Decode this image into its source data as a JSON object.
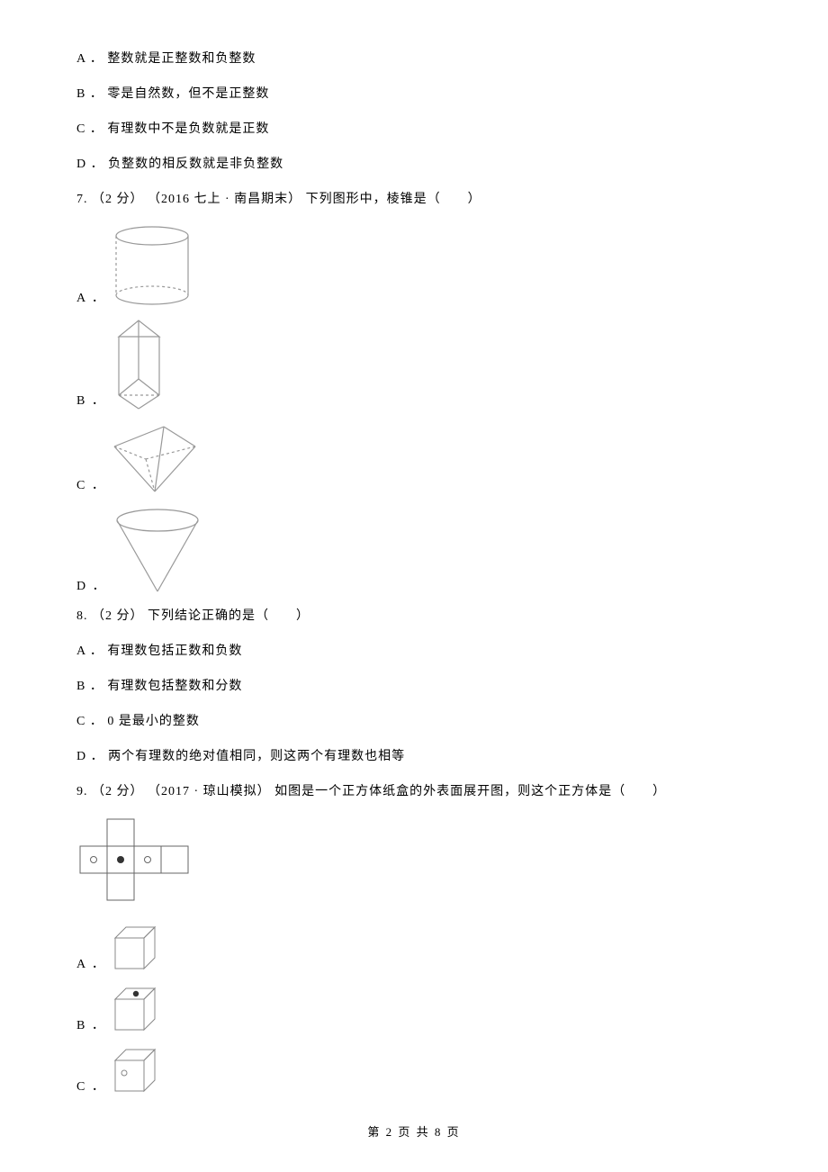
{
  "q6": {
    "a": "A ． 整数就是正整数和负整数",
    "b": "B ． 零是自然数，但不是正整数",
    "c": "C ． 有理数中不是负数就是正数",
    "d": "D ． 负整数的相反数就是非负整数"
  },
  "q7": {
    "stem": "7.  （2 分） （2016 七上 · 南昌期末）  下列图形中，棱锥是（　　）",
    "a": "A ．",
    "b": "B ．",
    "c": "C ．",
    "d": "D ．"
  },
  "q8": {
    "stem": "8.  （2 分）  下列结论正确的是（　　）",
    "a": "A ． 有理数包括正数和负数",
    "b": "B ． 有理数包括整数和分数",
    "c": "C ． 0 是最小的整数",
    "d": "D ． 两个有理数的绝对值相同，则这两个有理数也相等"
  },
  "q9": {
    "stem": "9.  （2 分） （2017 · 琼山模拟） 如图是一个正方体纸盒的外表面展开图，则这个正方体是（　　）",
    "a": "A ．",
    "b": "B ．",
    "c": "C ．"
  },
  "footer": "第 2 页 共 8 页"
}
